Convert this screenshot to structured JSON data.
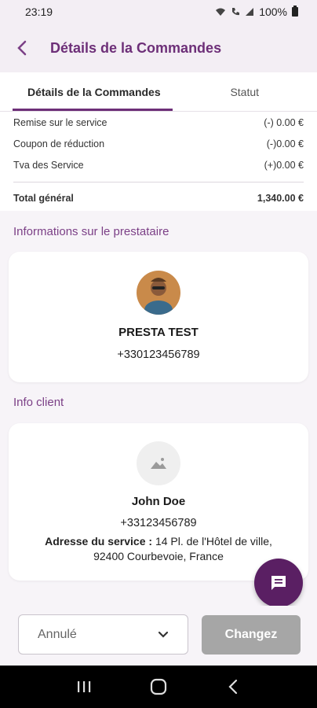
{
  "status_bar": {
    "time": "23:19",
    "battery": "100%"
  },
  "app_bar": {
    "title": "Détails de la Commandes"
  },
  "tabs": [
    {
      "label": "Détails de la Commandes",
      "active": true
    },
    {
      "label": "Statut",
      "active": false
    }
  ],
  "summary": {
    "rows": [
      {
        "label": "Remise sur le service",
        "value": "(-) 0.00 €"
      },
      {
        "label": "Coupon de réduction",
        "value": "(-)0.00 €"
      },
      {
        "label": "Tva des Service",
        "value": "(+)0.00 €"
      }
    ],
    "total": {
      "label": "Total général",
      "value": "1,340.00 €"
    }
  },
  "provider_section": {
    "title": "Informations sur le prestataire",
    "name": "PRESTA TEST",
    "phone": "+330123456789"
  },
  "client_section": {
    "title": "Info client",
    "name": "John Doe",
    "phone": "+33123456789",
    "address_label": "Adresse du service :",
    "address_line1": "14 Pl. de l'Hôtel de ville,",
    "address_line2": "92400 Courbevoie, France"
  },
  "bottom": {
    "status_select_value": "Annulé",
    "change_button_label": "Changez"
  },
  "colors": {
    "accent": "#6d2f78",
    "fab": "#5a1f63",
    "disabled_button": "#a6a6a6"
  }
}
